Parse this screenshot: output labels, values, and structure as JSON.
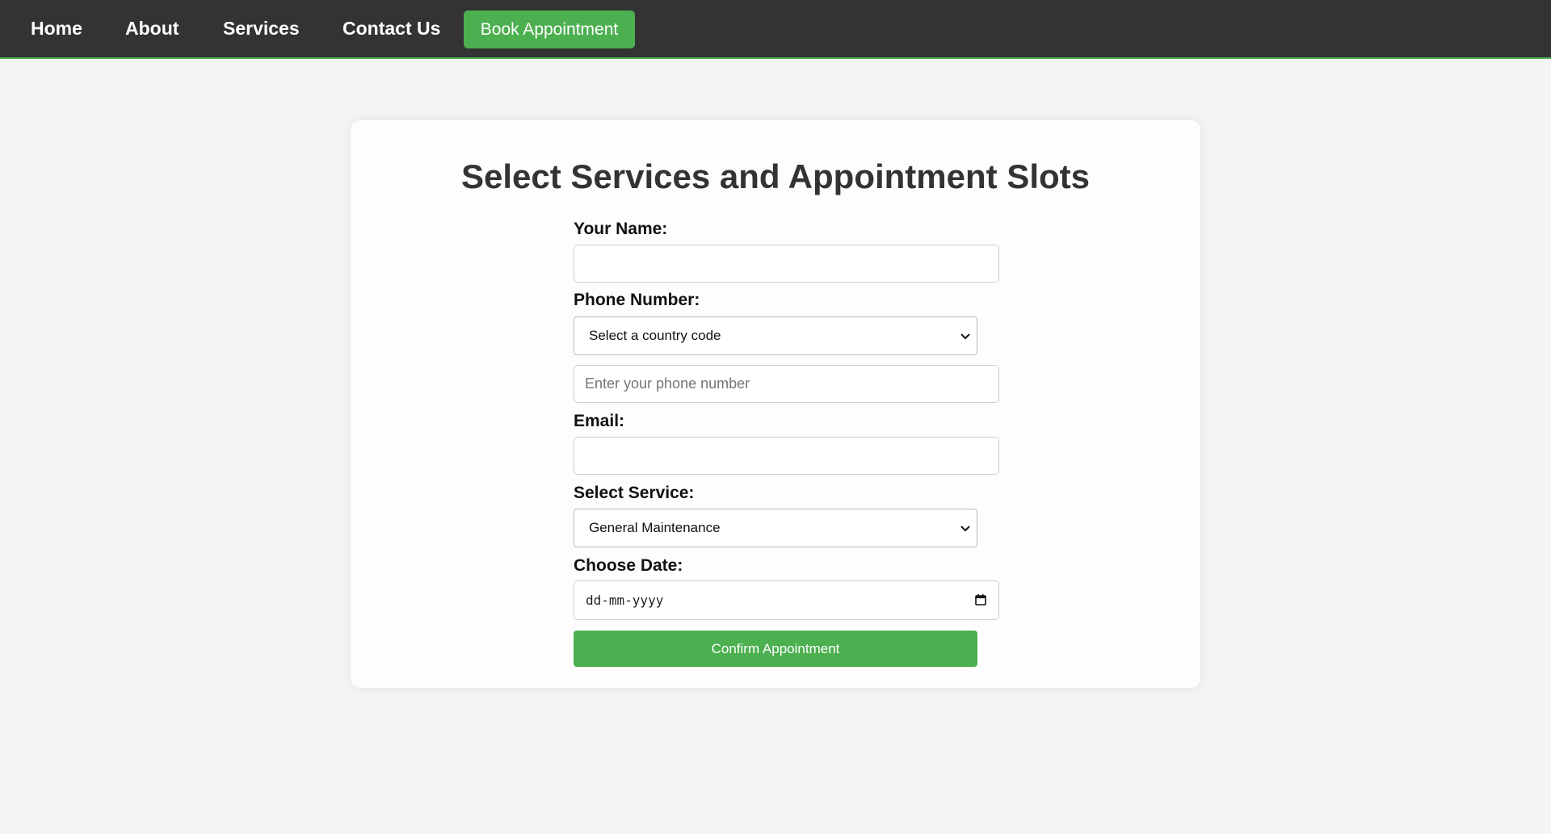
{
  "nav": {
    "home": "Home",
    "about": "About",
    "services": "Services",
    "contact": "Contact Us",
    "book": "Book Appointment"
  },
  "colors": {
    "navbar_bg": "#333333",
    "accent_green": "#4caf50",
    "page_bg": "#f4f4f4"
  },
  "form": {
    "title": "Select Services and Appointment Slots",
    "name_label": "Your Name:",
    "name_value": "",
    "phone_label": "Phone Number:",
    "country_code_selected": "Select a country code",
    "phone_value": "",
    "phone_placeholder": "Enter your phone number",
    "email_label": "Email:",
    "email_value": "",
    "service_label": "Select Service:",
    "service_selected": "General Maintenance",
    "date_label": "Choose Date:",
    "date_placeholder": "dd-mm-yyyy",
    "submit_label": "Confirm Appointment"
  },
  "icons": {
    "select_arrow": "chevron-down-icon",
    "date_picker": "calendar-icon"
  }
}
